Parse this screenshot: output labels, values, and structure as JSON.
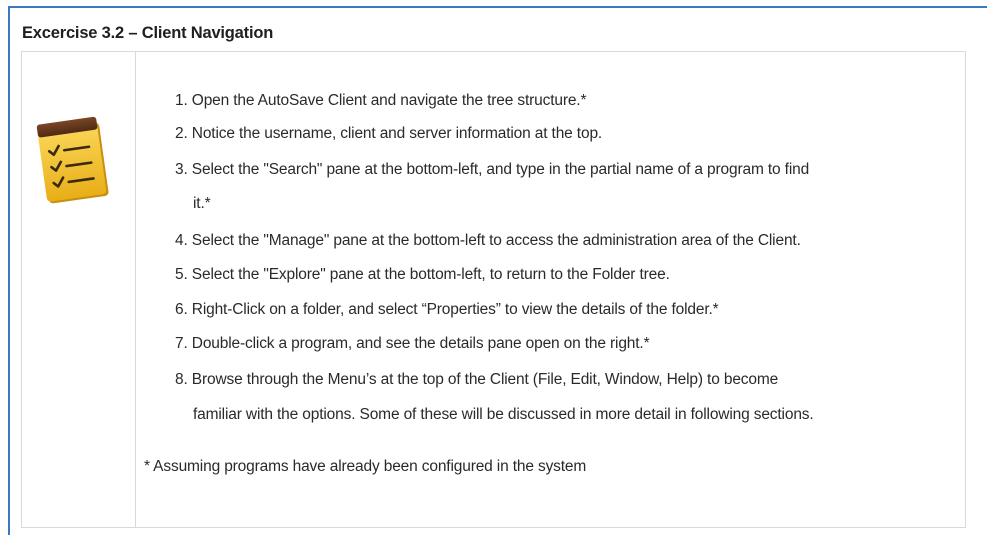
{
  "heading": "Excercise 3.2 – Client Navigation",
  "icon": "checklist-icon",
  "steps": [
    "1. Open the AutoSave Client and navigate the tree structure.*",
    "2. Notice the username, client and server information at the top.",
    "3. Select the \"Search\" pane at the bottom-left, and type in the partial name of a program to find",
    "it.*",
    "4. Select the \"Manage\" pane at the bottom-left to access the administration area of the Client.",
    "5. Select the \"Explore\" pane at the bottom-left, to return to the Folder tree.",
    "6. Right-Click on a folder, and select “Properties” to view the details of the folder.*",
    "7. Double-click a program, and see the details pane open on the right.*",
    "8. Browse through the Menu’s at the top of the Client (File, Edit, Window, Help) to become",
    "familiar with the options.  Some of these will be discussed in more detail in following sections."
  ],
  "footnote": "* Assuming programs have already been configured in the system",
  "colors": {
    "frame": "#3b78c2",
    "notepad_yellow": "#f2c12e",
    "notepad_header": "#6b3a1f"
  }
}
